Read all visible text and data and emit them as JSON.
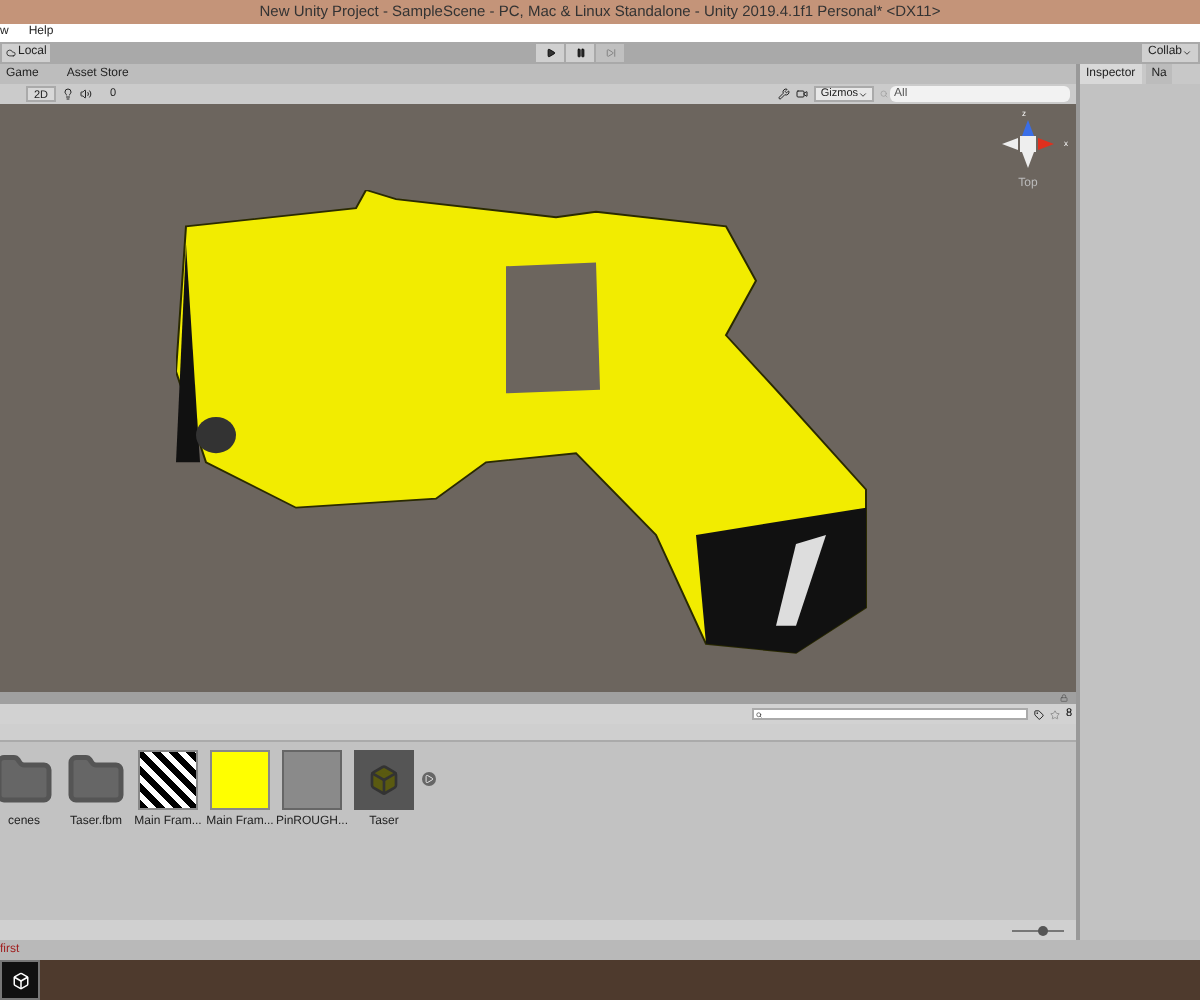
{
  "window": {
    "title": "New Unity Project - SampleScene - PC, Mac & Linux Standalone - Unity 2019.4.1f1 Personal* <DX11>"
  },
  "menu": [
    "w",
    "Help"
  ],
  "toolbar": {
    "account": "Local",
    "collab": "Collab"
  },
  "scene_tabs": [
    {
      "label": "Game",
      "selected": false
    },
    {
      "label": "Asset Store",
      "selected": false
    }
  ],
  "scene_toolbar": {
    "mode": "2D",
    "hidden_count": "0",
    "gizmos": "Gizmos",
    "search_placeholder": "All"
  },
  "orientation_gizmo": {
    "axis_y": "z",
    "axis_x": "x",
    "view": "Top"
  },
  "right_tabs": [
    {
      "label": "Inspector",
      "selected": true
    },
    {
      "label": "Na",
      "selected": false
    }
  ],
  "project": {
    "count": "8",
    "zoom": {
      "level": 0.6
    },
    "assets": [
      {
        "kind": "folder",
        "label": "cenes"
      },
      {
        "kind": "folder",
        "label": "Taser.fbm"
      },
      {
        "kind": "pattern",
        "label": "Main Fram..."
      },
      {
        "kind": "yellow",
        "label": "Main Fram..."
      },
      {
        "kind": "material",
        "label": "PinROUGH..."
      },
      {
        "kind": "model",
        "label": "Taser"
      }
    ]
  },
  "status_bar": {
    "message": "first"
  }
}
